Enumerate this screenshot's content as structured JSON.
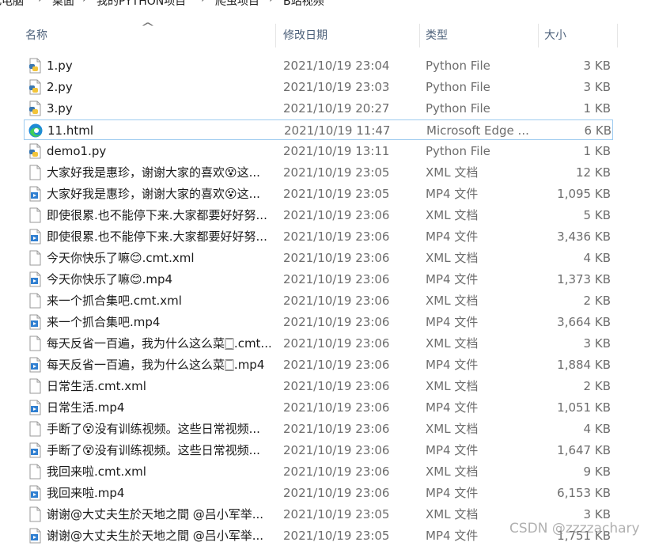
{
  "breadcrumb": [
    {
      "label": "此电脑"
    },
    {
      "label": "桌面"
    },
    {
      "label": "我的PYTHON项目"
    },
    {
      "label": "爬虫项目"
    },
    {
      "label": "B站视频"
    }
  ],
  "columns": {
    "name": "名称",
    "date": "修改日期",
    "type": "类型",
    "size": "大小"
  },
  "files": [
    {
      "name": "1.py",
      "date": "2021/10/19 23:04",
      "type": "Python File",
      "size": "3 KB",
      "icon": "python-file-icon"
    },
    {
      "name": "2.py",
      "date": "2021/10/19 23:03",
      "type": "Python File",
      "size": "3 KB",
      "icon": "python-file-icon"
    },
    {
      "name": "3.py",
      "date": "2021/10/19 20:27",
      "type": "Python File",
      "size": "1 KB",
      "icon": "python-file-icon"
    },
    {
      "name": "11.html",
      "date": "2021/10/19 11:47",
      "type": "Microsoft Edge ...",
      "size": "6 KB",
      "icon": "edge-html-icon",
      "selected": true
    },
    {
      "name": "demo1.py",
      "date": "2021/10/19 13:11",
      "type": "Python File",
      "size": "1 KB",
      "icon": "python-file-icon"
    },
    {
      "name": "大家好我是惠珍，谢谢大家的喜欢😵这...",
      "date": "2021/10/19 23:05",
      "type": "XML 文档",
      "size": "12 KB",
      "icon": "xml-file-icon"
    },
    {
      "name": "大家好我是惠珍，谢谢大家的喜欢😵这...",
      "date": "2021/10/19 23:05",
      "type": "MP4 文件",
      "size": "1,095 KB",
      "icon": "mp4-file-icon"
    },
    {
      "name": "即使很累.也不能停下来.大家都要好好努...",
      "date": "2021/10/19 23:06",
      "type": "XML 文档",
      "size": "5 KB",
      "icon": "xml-file-icon"
    },
    {
      "name": "即使很累.也不能停下来.大家都要好好努...",
      "date": "2021/10/19 23:06",
      "type": "MP4 文件",
      "size": "3,436 KB",
      "icon": "mp4-file-icon"
    },
    {
      "name": "今天你快乐了嘛😊.cmt.xml",
      "date": "2021/10/19 23:06",
      "type": "XML 文档",
      "size": "4 KB",
      "icon": "xml-file-icon"
    },
    {
      "name": "今天你快乐了嘛😊.mp4",
      "date": "2021/10/19 23:06",
      "type": "MP4 文件",
      "size": "1,373 KB",
      "icon": "mp4-file-icon"
    },
    {
      "name": "来一个抓合集吧.cmt.xml",
      "date": "2021/10/19 23:06",
      "type": "XML 文档",
      "size": "2 KB",
      "icon": "xml-file-icon"
    },
    {
      "name": "来一个抓合集吧.mp4",
      "date": "2021/10/19 23:06",
      "type": "MP4 文件",
      "size": "3,664 KB",
      "icon": "mp4-file-icon"
    },
    {
      "name": "每天反省一百遍，我为什么这么菜🀆.cmt...",
      "date": "2021/10/19 23:06",
      "type": "XML 文档",
      "size": "3 KB",
      "icon": "xml-file-icon"
    },
    {
      "name": "每天反省一百遍，我为什么这么菜🀆.mp4",
      "date": "2021/10/19 23:06",
      "type": "MP4 文件",
      "size": "1,884 KB",
      "icon": "mp4-file-icon"
    },
    {
      "name": "日常生活.cmt.xml",
      "date": "2021/10/19 23:06",
      "type": "XML 文档",
      "size": "2 KB",
      "icon": "xml-file-icon"
    },
    {
      "name": "日常生活.mp4",
      "date": "2021/10/19 23:06",
      "type": "MP4 文件",
      "size": "1,051 KB",
      "icon": "mp4-file-icon"
    },
    {
      "name": "手断了😵没有训练视频。这些日常视频...",
      "date": "2021/10/19 23:06",
      "type": "XML 文档",
      "size": "4 KB",
      "icon": "xml-file-icon"
    },
    {
      "name": "手断了😵没有训练视频。这些日常视频...",
      "date": "2021/10/19 23:06",
      "type": "MP4 文件",
      "size": "1,647 KB",
      "icon": "mp4-file-icon"
    },
    {
      "name": "我回来啦.cmt.xml",
      "date": "2021/10/19 23:06",
      "type": "XML 文档",
      "size": "9 KB",
      "icon": "xml-file-icon"
    },
    {
      "name": "我回来啦.mp4",
      "date": "2021/10/19 23:06",
      "type": "MP4 文件",
      "size": "6,153 KB",
      "icon": "mp4-file-icon"
    },
    {
      "name": "谢谢@大丈夫生於天地之間 @吕小军举...",
      "date": "2021/10/19 23:05",
      "type": "XML 文档",
      "size": "3 KB",
      "icon": "xml-file-icon"
    },
    {
      "name": "谢谢@大丈夫生於天地之間 @吕小军举...",
      "date": "2021/10/19 23:05",
      "type": "MP4 文件",
      "size": "1,751 KB",
      "icon": "mp4-file-icon"
    }
  ],
  "watermark": "CSDN @zzzzachary"
}
